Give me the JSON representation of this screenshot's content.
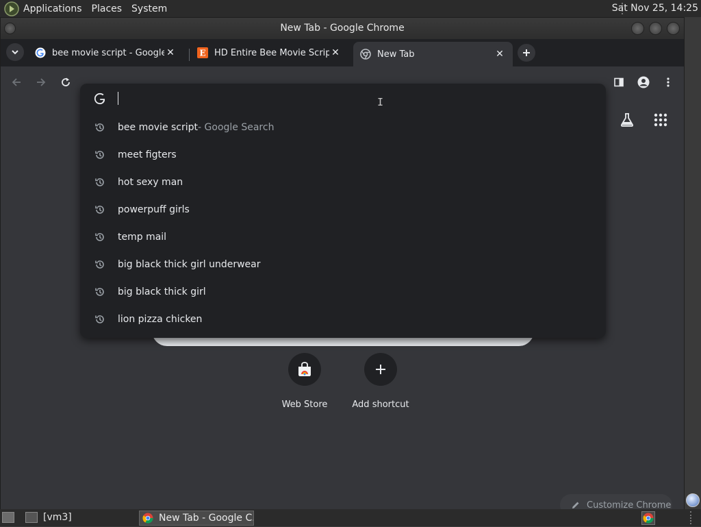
{
  "panel": {
    "menus": [
      "Applications",
      "Places",
      "System"
    ],
    "clock": "Sat Nov 25, 14:25"
  },
  "window": {
    "title": "New Tab - Google Chrome"
  },
  "tabs": [
    {
      "title": "bee movie script - Google Search",
      "favicon": "google-g-icon"
    },
    {
      "title": "HD Entire Bee Movie Script Meme",
      "favicon": "etsy-e-icon"
    },
    {
      "title": "New Tab",
      "favicon": "chrome-icon",
      "active": true
    }
  ],
  "omnibox": {
    "input_value": "",
    "suggestions": [
      {
        "text": "bee movie script",
        "suffix": " - Google Search"
      },
      {
        "text": "meet figters",
        "suffix": ""
      },
      {
        "text": "hot sexy man",
        "suffix": ""
      },
      {
        "text": "powerpuff girls",
        "suffix": ""
      },
      {
        "text": "temp mail",
        "suffix": ""
      },
      {
        "text": "big black thick girl underwear",
        "suffix": ""
      },
      {
        "text": "big black thick girl",
        "suffix": ""
      },
      {
        "text": "lion pizza chicken",
        "suffix": ""
      }
    ]
  },
  "ntp": {
    "shortcuts": [
      {
        "label": "Web Store",
        "icon": "web-store-icon"
      },
      {
        "label": "Add shortcut",
        "icon": "plus-icon"
      }
    ],
    "customize_label": "Customize Chrome"
  },
  "taskbar": {
    "workspace": "[vm3]",
    "task_label": "New Tab - Google C..."
  },
  "colors": {
    "tabstrip_bg": "#202124",
    "toolbar_bg": "#35363a",
    "popup_bg": "#202124",
    "text": "#e8eaed",
    "muted": "#9aa0a6"
  }
}
